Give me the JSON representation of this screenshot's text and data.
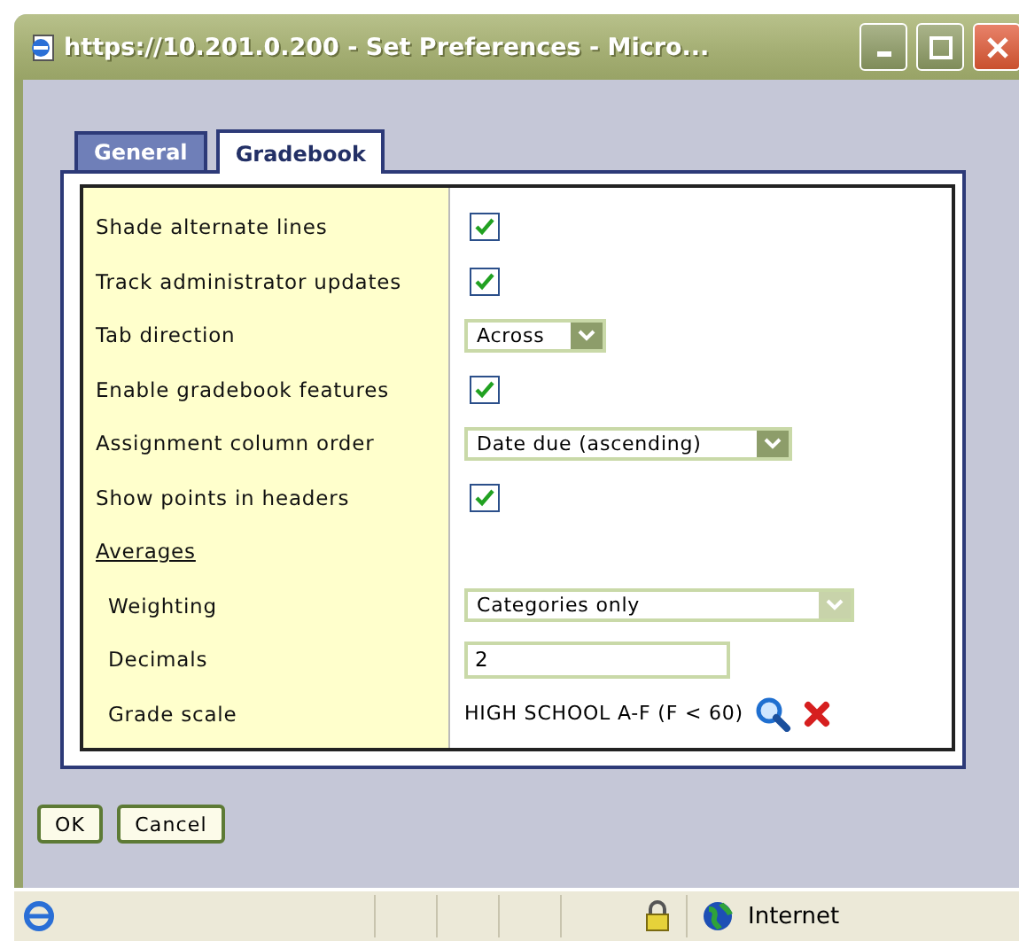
{
  "window": {
    "title": "https://10.201.0.200 - Set Preferences - Micro..."
  },
  "tabs": [
    {
      "label": "General",
      "selected": false
    },
    {
      "label": "Gradebook",
      "selected": true
    }
  ],
  "settings": [
    {
      "kind": "checkbox",
      "label": "Shade alternate lines",
      "checked": true
    },
    {
      "kind": "checkbox",
      "label": "Track administrator updates",
      "checked": true
    },
    {
      "kind": "select",
      "label": "Tab direction",
      "value": "Across",
      "disabled": false
    },
    {
      "kind": "checkbox",
      "label": "Enable gradebook features",
      "checked": true
    },
    {
      "kind": "select",
      "label": "Assignment column order",
      "value": "Date due (ascending)",
      "disabled": false
    },
    {
      "kind": "checkbox",
      "label": "Show points in headers",
      "checked": true
    },
    {
      "kind": "heading",
      "label": "Averages"
    },
    {
      "kind": "select",
      "label": "Weighting",
      "value": "Categories only",
      "disabled": true
    },
    {
      "kind": "input",
      "label": "Decimals",
      "value": "2"
    },
    {
      "kind": "scale",
      "label": "Grade scale",
      "value": "HIGH SCHOOL A-F (F < 60)"
    }
  ],
  "buttons": [
    "OK",
    "Cancel"
  ],
  "status_bar": {
    "zone": "Internet"
  }
}
